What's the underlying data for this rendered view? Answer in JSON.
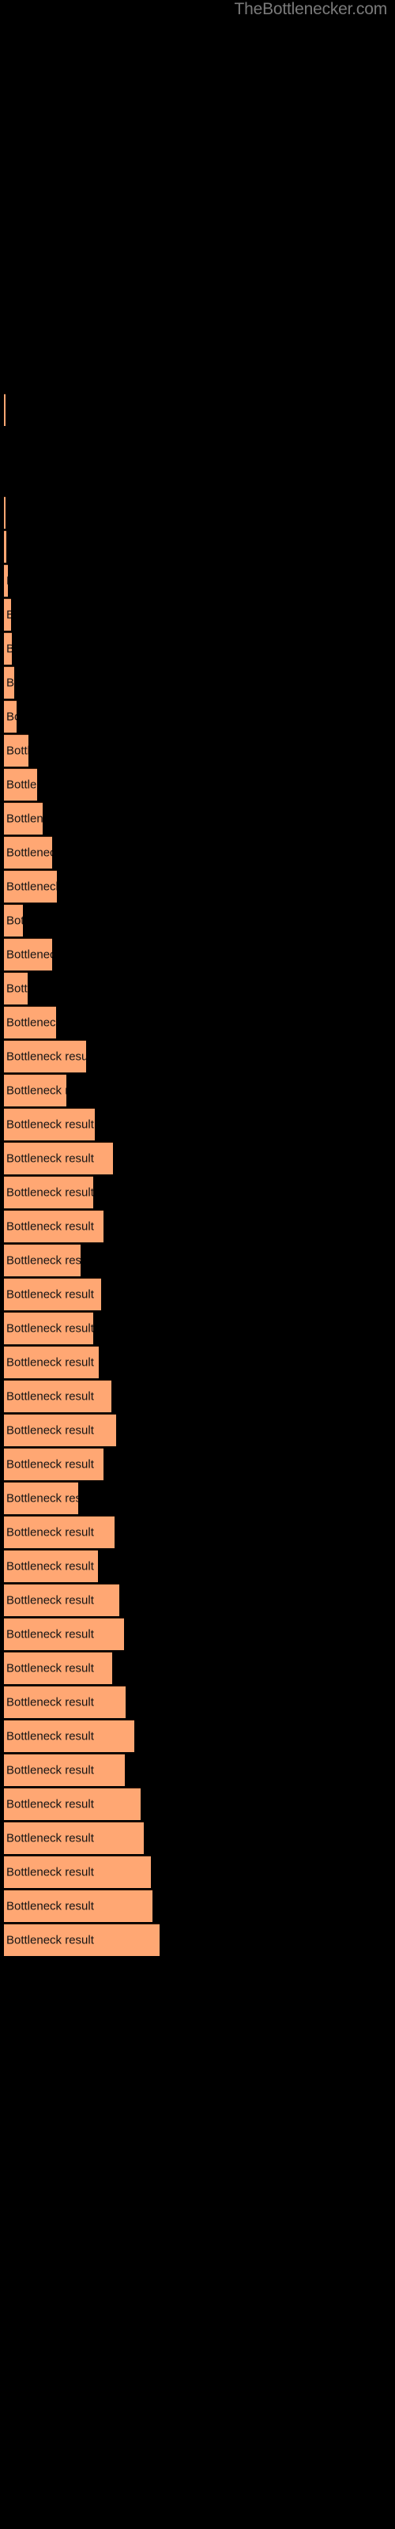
{
  "header": {
    "wordmark": "TheBottlenecker.com"
  },
  "chart_data": {
    "type": "bar",
    "orientation": "horizontal",
    "title": "",
    "subtitle": "",
    "xlabel": "",
    "ylabel": "",
    "grid": false,
    "legend": null,
    "background_color": "#000000",
    "bar_color": "#ffa773",
    "bar_border_color": "#3d1f0c",
    "label_color": "#141414",
    "wordmark_color": "#7a7a7a",
    "bar_label_text": "Bottleneck result",
    "axis_ranges": {
      "xlim": [
        0,
        192
      ],
      "x_units": "pixels"
    },
    "categories": [
      "Bottleneck result",
      "Bottleneck result",
      "Bottleneck result",
      "Bottleneck result",
      "Bottleneck result",
      "Bottleneck result",
      "Bottleneck result",
      "Bottleneck result",
      "Bottleneck result",
      "Bottleneck result",
      "Bottleneck result",
      "Bottleneck result",
      "Bottleneck result",
      "Bottleneck result",
      "Bottleneck result",
      "Bottleneck result",
      "Bottleneck result",
      "Bottleneck result",
      "Bottleneck result",
      "Bottleneck result",
      "Bottleneck result",
      "Bottleneck result",
      "Bottleneck result",
      "Bottleneck result",
      "Bottleneck result",
      "Bottleneck result",
      "Bottleneck result",
      "Bottleneck result",
      "Bottleneck result",
      "Bottleneck result",
      "Bottleneck result",
      "Bottleneck result"
    ],
    "values": [
      2,
      2,
      3,
      5,
      9,
      10,
      13,
      16,
      31,
      42,
      49,
      61,
      67,
      75,
      85,
      91,
      96,
      100,
      104,
      109,
      113,
      118,
      122,
      126,
      135,
      142,
      148,
      155,
      162,
      168,
      177,
      192
    ],
    "bars": [
      {
        "index": 0,
        "y": 498,
        "width": 2,
        "label": "Bottleneck result"
      },
      {
        "index": 1,
        "y": 628,
        "width": 2,
        "label": "Bottleneck result"
      },
      {
        "index": 2,
        "y": 671,
        "width": 3,
        "label": "Bottleneck result"
      },
      {
        "index": 3,
        "y": 714,
        "width": 5,
        "label": "Bottleneck result"
      },
      {
        "index": 4,
        "y": 757,
        "width": 9,
        "label": "Bottleneck result"
      },
      {
        "index": 5,
        "y": 800,
        "width": 10,
        "label": "Bottleneck result"
      },
      {
        "index": 6,
        "y": 843,
        "width": 13,
        "label": "Bottleneck result"
      },
      {
        "index": 7,
        "y": 886,
        "width": 16,
        "label": "Bottleneck result"
      },
      {
        "index": 8,
        "y": 929,
        "width": 31,
        "label": "Bottleneck result"
      },
      {
        "index": 9,
        "y": 972,
        "width": 42,
        "label": "Bottleneck result"
      },
      {
        "index": 10,
        "y": 1015,
        "width": 49,
        "label": "Bottleneck result"
      },
      {
        "index": 11,
        "y": 1058,
        "width": 61,
        "label": "Bottleneck result"
      },
      {
        "index": 12,
        "y": 1101,
        "width": 67,
        "label": "Bottleneck result"
      },
      {
        "index": 13,
        "y": 1144,
        "width": 24,
        "label": "Bottleneck result"
      },
      {
        "index": 14,
        "y": 1187,
        "width": 61,
        "label": "Bottleneck result"
      },
      {
        "index": 15,
        "y": 1230,
        "width": 30,
        "label": "Bottleneck result"
      },
      {
        "index": 16,
        "y": 1273,
        "width": 66,
        "label": "Bottleneck result"
      },
      {
        "index": 17,
        "y": 1316,
        "width": 104,
        "label": "Bottleneck result"
      },
      {
        "index": 18,
        "y": 1359,
        "width": 79,
        "label": "Bottleneck result"
      },
      {
        "index": 19,
        "y": 1402,
        "width": 115,
        "label": "Bottleneck result"
      },
      {
        "index": 20,
        "y": 1445,
        "width": 138,
        "label": "Bottleneck result"
      },
      {
        "index": 21,
        "y": 1488,
        "width": 113,
        "label": "Bottleneck result"
      },
      {
        "index": 22,
        "y": 1531,
        "width": 126,
        "label": "Bottleneck result"
      },
      {
        "index": 23,
        "y": 1574,
        "width": 97,
        "label": "Bottleneck result"
      },
      {
        "index": 24,
        "y": 1617,
        "width": 123,
        "label": "Bottleneck result"
      },
      {
        "index": 25,
        "y": 1660,
        "width": 113,
        "label": "Bottleneck result"
      },
      {
        "index": 26,
        "y": 1703,
        "width": 120,
        "label": "Bottleneck result"
      },
      {
        "index": 27,
        "y": 1746,
        "width": 136,
        "label": "Bottleneck result"
      },
      {
        "index": 28,
        "y": 1789,
        "width": 142,
        "label": "Bottleneck result"
      },
      {
        "index": 29,
        "y": 1832,
        "width": 126,
        "label": "Bottleneck result"
      },
      {
        "index": 30,
        "y": 1875,
        "width": 94,
        "label": "Bottleneck result"
      },
      {
        "index": 31,
        "y": 1918,
        "width": 140,
        "label": "Bottleneck result"
      },
      {
        "index": 32,
        "y": 1961,
        "width": 119,
        "label": "Bottleneck result"
      },
      {
        "index": 33,
        "y": 2004,
        "width": 146,
        "label": "Bottleneck result"
      },
      {
        "index": 34,
        "y": 2047,
        "width": 152,
        "label": "Bottleneck result"
      },
      {
        "index": 35,
        "y": 2090,
        "width": 137,
        "label": "Bottleneck result"
      },
      {
        "index": 36,
        "y": 2133,
        "width": 154,
        "label": "Bottleneck result"
      },
      {
        "index": 37,
        "y": 2176,
        "width": 165,
        "label": "Bottleneck result"
      },
      {
        "index": 38,
        "y": 2219,
        "width": 153,
        "label": "Bottleneck result"
      },
      {
        "index": 39,
        "y": 2262,
        "width": 173,
        "label": "Bottleneck result"
      },
      {
        "index": 40,
        "y": 2305,
        "width": 177,
        "label": "Bottleneck result"
      },
      {
        "index": 41,
        "y": 2348,
        "width": 186,
        "label": "Bottleneck result"
      },
      {
        "index": 42,
        "y": 2391,
        "width": 188,
        "label": "Bottleneck result"
      },
      {
        "index": 43,
        "y": 2434,
        "width": 197,
        "label": "Bottleneck result"
      }
    ]
  },
  "bars_final": [
    {
      "y": 498,
      "w": 2
    },
    {
      "y": 628,
      "w": 2
    },
    {
      "y": 671,
      "w": 3
    },
    {
      "y": 714,
      "w": 5
    },
    {
      "y": 757,
      "w": 9
    },
    {
      "y": 800,
      "w": 13
    },
    {
      "y": 843,
      "w": 16
    },
    {
      "y": 886,
      "w": 24
    },
    {
      "y": 929,
      "w": 31
    },
    {
      "y": 972,
      "w": 42
    },
    {
      "y": 1015,
      "w": 49
    },
    {
      "y": 1058,
      "w": 61
    },
    {
      "y": 1101,
      "w": 67
    },
    {
      "y": 1144,
      "w": 75
    },
    {
      "y": 1187,
      "w": 85
    },
    {
      "y": 1230,
      "w": 91
    },
    {
      "y": 1273,
      "w": 96
    },
    {
      "y": 1316,
      "w": 100
    },
    {
      "y": 1359,
      "w": 104
    },
    {
      "y": 1402,
      "w": 109
    },
    {
      "y": 1445,
      "w": 113
    },
    {
      "y": 1488,
      "w": 118
    },
    {
      "y": 1531,
      "w": 122
    },
    {
      "y": 1574,
      "w": 126
    },
    {
      "y": 1617,
      "w": 131
    },
    {
      "y": 1660,
      "w": 135
    },
    {
      "y": 1703,
      "w": 139
    },
    {
      "y": 1746,
      "w": 142
    },
    {
      "y": 1789,
      "w": 146
    },
    {
      "y": 1832,
      "w": 149
    },
    {
      "y": 1875,
      "w": 152
    },
    {
      "y": 1918,
      "w": 155
    },
    {
      "y": 1961,
      "w": 158
    },
    {
      "y": 2004,
      "w": 161
    },
    {
      "y": 2047,
      "w": 164
    },
    {
      "y": 2090,
      "w": 167
    },
    {
      "y": 2133,
      "w": 169
    },
    {
      "y": 2176,
      "w": 172
    },
    {
      "y": 2219,
      "w": 175
    },
    {
      "y": 2262,
      "w": 178
    },
    {
      "y": 2305,
      "w": 181
    },
    {
      "y": 2348,
      "w": 184
    },
    {
      "y": 2391,
      "w": 187
    },
    {
      "y": 2434,
      "w": 190
    }
  ]
}
